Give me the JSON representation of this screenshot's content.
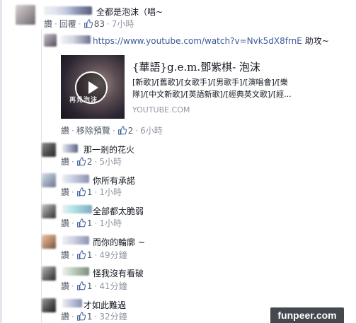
{
  "like_label": "讚",
  "reply_label": "回覆",
  "remove_preview_label": "移除預覽",
  "dot": "·",
  "colors": {
    "link": "#3b5998",
    "meta": "#4e5665",
    "time": "#9197a3",
    "text": "#141823"
  },
  "top_comment": {
    "text": "全都是泡沫（唱~",
    "like_count": "83",
    "time": "7小時"
  },
  "reply_url": {
    "url": "https://www.youtube.com/watch?v=Nvk5dX8frnE",
    "suffix": "助攻~",
    "like_count": "2",
    "time": "6小時"
  },
  "preview": {
    "title": "{華語}g.e.m.鄧紫棋- 泡沫",
    "desc_line1": "[新歌]/[舊歌]/[女歌手]/[男歌手]/[演唱會]/[樂",
    "desc_line2": "隊]/[中文新歌]/[英語新歌]/[經典英文歌]/[經...",
    "domain": "YOUTUBE.COM",
    "thumb_caption": "再見泡沫",
    "play_icon": "play-icon"
  },
  "replies": [
    {
      "text": "那一剎的花火",
      "like_count": "2",
      "time": "5小時"
    },
    {
      "text": "你所有承諾",
      "like_count": "1",
      "time": "1小時"
    },
    {
      "text": "全部都太脆弱",
      "like_count": "1",
      "time": "1小時"
    },
    {
      "text": "而你的輪廓 ~",
      "like_count": "1",
      "time": "49分鐘"
    },
    {
      "text": "怪我沒有看破",
      "like_count": "1",
      "time": "41分鐘"
    },
    {
      "text": "才如此難過",
      "like_count": "1",
      "time": "32分鐘"
    }
  ],
  "watermark": "funpeer.com"
}
